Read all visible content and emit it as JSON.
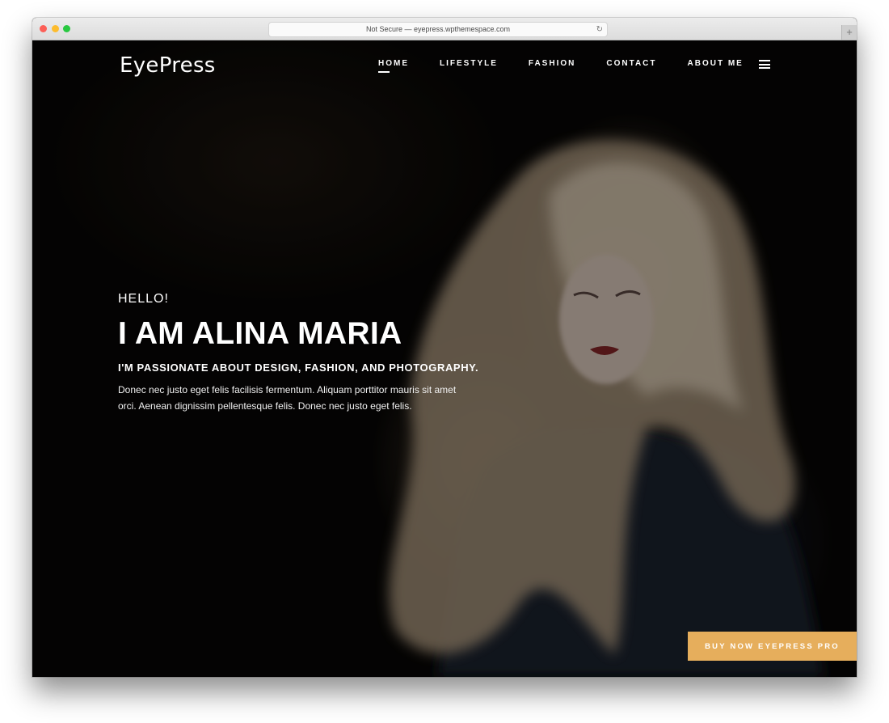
{
  "browser": {
    "address": "Not Secure — eyepress.wpthemespace.com",
    "reload_icon": "↻",
    "new_tab_icon": "+"
  },
  "header": {
    "logo": "EyePress",
    "nav": [
      {
        "label": "HOME",
        "active": true
      },
      {
        "label": "LIFESTYLE",
        "active": false
      },
      {
        "label": "FASHION",
        "active": false
      },
      {
        "label": "CONTACT",
        "active": false
      },
      {
        "label": "ABOUT ME",
        "active": false
      }
    ]
  },
  "hero": {
    "greeting": "HELLO!",
    "title": "I AM ALINA MARIA",
    "subtitle": "I'M PASSIONATE ABOUT DESIGN, FASHION, AND PHOTOGRAPHY.",
    "description": "Donec nec justo eget felis facilisis fermentum. Aliquam porttitor mauris sit amet orci. Aenean dignissim pellentesque felis. Donec nec justo eget felis."
  },
  "cta": {
    "label": "BUY NOW EYEPRESS PRO",
    "color": "#e6ae5c"
  }
}
